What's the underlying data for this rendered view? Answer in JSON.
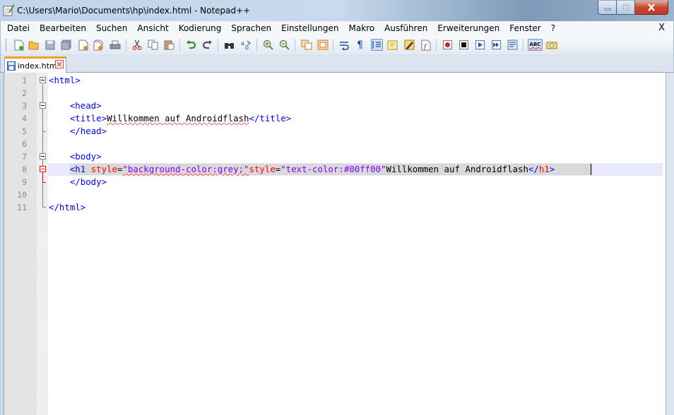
{
  "window": {
    "title": "C:\\Users\\Mario\\Documents\\hp\\index.html - Notepad++",
    "minimize_label": "minimize",
    "maximize_label": "maximize",
    "close_label": "close"
  },
  "menu": {
    "items": [
      "Datei",
      "Bearbeiten",
      "Suchen",
      "Ansicht",
      "Kodierung",
      "Sprachen",
      "Einstellungen",
      "Makro",
      "Ausführen",
      "Erweiterungen",
      "Fenster",
      "?"
    ],
    "close_label": "X"
  },
  "toolbar": {
    "buttons": [
      "new-file",
      "open-file",
      "save",
      "save-all",
      "close",
      "close-all",
      "print",
      "cut",
      "copy",
      "paste",
      "undo",
      "redo",
      "find",
      "replace",
      "zoom-in",
      "zoom-out",
      "sync-vertical",
      "sync-horizontal",
      "word-wrap",
      "show-all-characters",
      "indent-guide",
      "user-defined-language",
      "document-map",
      "function-list",
      "record-macro",
      "stop-recording",
      "play-macro",
      "run-macro-multiple",
      "save-macro",
      "spell-check",
      "spell-check-options"
    ],
    "spellcheck_label": "ABC"
  },
  "tabs": [
    {
      "label": "index.html",
      "active": true
    }
  ],
  "editor": {
    "line_numbers": [
      "1",
      "2",
      "3",
      "4",
      "5",
      "6",
      "7",
      "8",
      "9",
      "10",
      "11"
    ],
    "lines": [
      "<html>",
      "",
      "    <head>",
      "    <title>Willkommen auf Androidflash</title>",
      "    </head>",
      "",
      "    <body>",
      "    <h1 style=\"background-color:grey;\"style=\"text-color:#00ff00\"Willkommen auf Androidflash</h1>",
      "    </body>",
      "",
      "</html>"
    ],
    "current_line": 8
  },
  "colors": {
    "tag": "#0000ff",
    "attribute": "#ff0000",
    "attribute_value": "#8000ff",
    "text": "#000000",
    "current_line_background": "#e8e8ff",
    "tab_accent": "#f4a020"
  }
}
